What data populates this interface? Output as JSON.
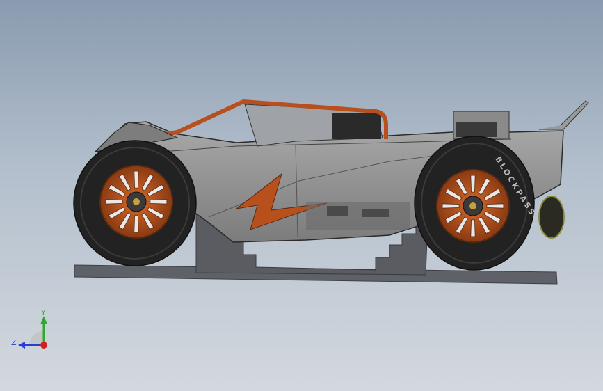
{
  "viewport": {
    "background_top": "#8a9bb0",
    "background_bottom": "#d3d8de"
  },
  "model": {
    "wheel_text": "BLOCKPASS",
    "colors": {
      "body": "#9b9b9b",
      "body_dark": "#6d6d6d",
      "accent": "#b8501e",
      "tire": "#222222",
      "stand": "#5f6168"
    }
  },
  "triad": {
    "y_label": "Y",
    "z_label": "Z",
    "y_color": "#2eaa2e",
    "z_color": "#2a3fd0",
    "x_color": "#d02020"
  }
}
